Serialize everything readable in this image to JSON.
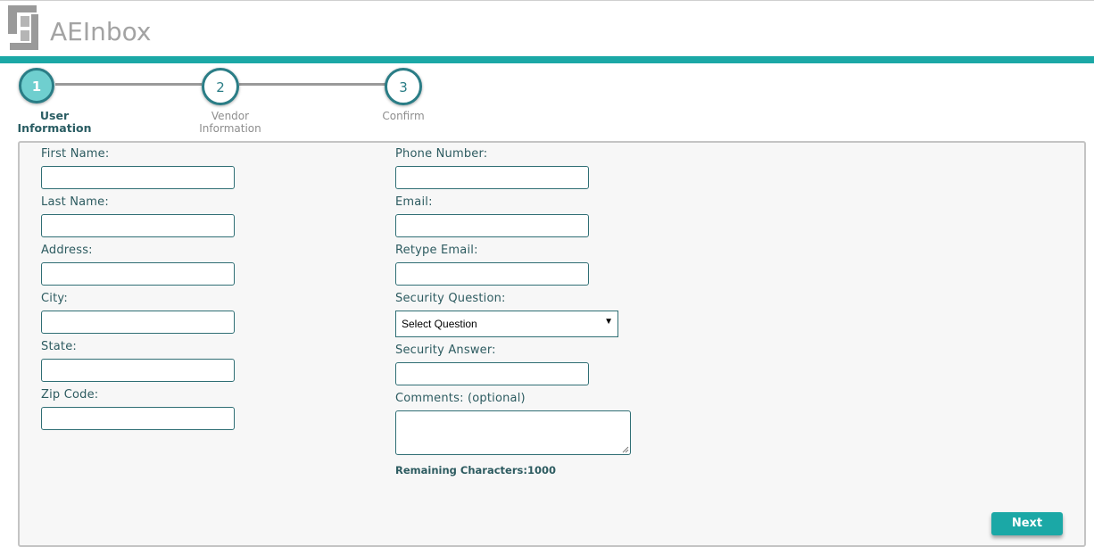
{
  "header": {
    "brand": "AEInbox",
    "brand_color": "#a3a3a3",
    "accent_color": "#1ba8a6"
  },
  "stepper": {
    "steps": [
      {
        "number": "1",
        "label_line1": "User",
        "label_line2": "Information",
        "state": "active"
      },
      {
        "number": "2",
        "label_line1": "Vendor",
        "label_line2": "Information",
        "state": "inactive"
      },
      {
        "number": "3",
        "label_line1": "Confirm",
        "label_line2": "",
        "state": "inactive"
      }
    ]
  },
  "form": {
    "left": {
      "first_name": {
        "label": "First Name:",
        "value": ""
      },
      "last_name": {
        "label": "Last Name:",
        "value": ""
      },
      "address": {
        "label": "Address:",
        "value": ""
      },
      "city": {
        "label": "City:",
        "value": ""
      },
      "state": {
        "label": "State:",
        "value": ""
      },
      "zip": {
        "label": "Zip Code:",
        "value": ""
      }
    },
    "right": {
      "phone": {
        "label": "Phone Number:",
        "value": ""
      },
      "email": {
        "label": "Email:",
        "value": ""
      },
      "retype_email": {
        "label": "Retype Email:",
        "value": ""
      },
      "security_question": {
        "label": "Security Question:",
        "selected": "Select Question"
      },
      "security_answer": {
        "label": "Security Answer:",
        "value": ""
      },
      "comments": {
        "label": "Comments: (optional)",
        "value": ""
      }
    },
    "remaining_characters": "Remaining Characters:1000",
    "next_label": "Next"
  }
}
